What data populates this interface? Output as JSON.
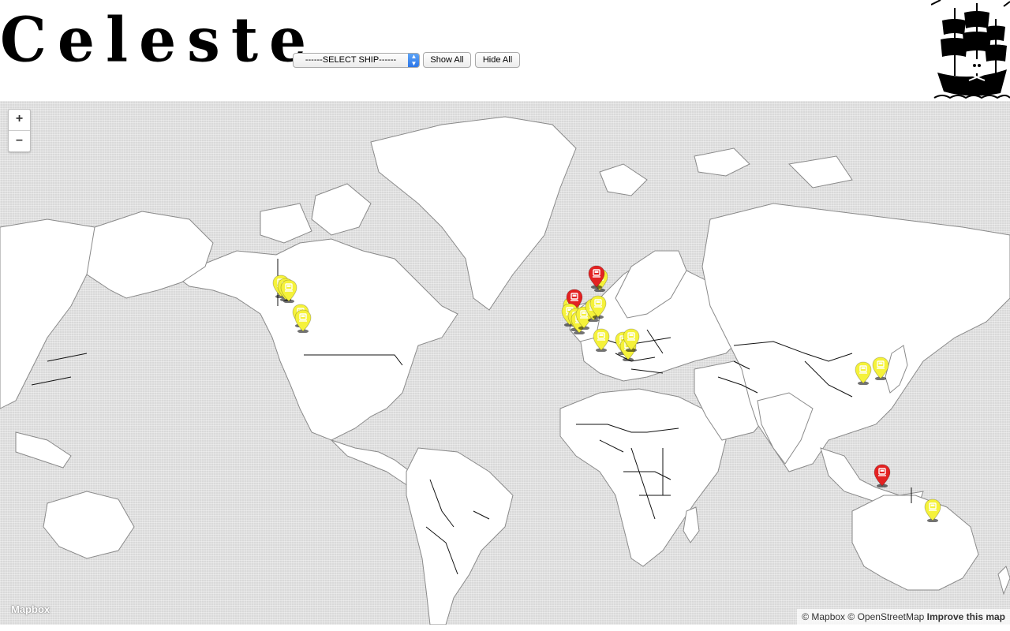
{
  "header": {
    "logo_text": "Celeste",
    "select": {
      "selected": "------SELECT SHIP------"
    },
    "show_all_label": "Show All",
    "hide_all_label": "Hide All"
  },
  "map": {
    "zoom_in_label": "+",
    "zoom_out_label": "–",
    "brand_label": "Mapbox",
    "attribution": {
      "mapbox": "© Mapbox",
      "osm": "© OpenStreetMap",
      "improve": "Improve this map"
    },
    "marker_colors": {
      "default": "#f5f23a",
      "selected": "#e32222"
    },
    "markers": [
      {
        "id": "m1",
        "color": "yellow",
        "icon": "ship-icon"
      },
      {
        "id": "m2",
        "color": "yellow",
        "icon": "ship-icon"
      },
      {
        "id": "m3",
        "color": "yellow",
        "icon": "ship-icon"
      },
      {
        "id": "m4",
        "color": "yellow",
        "icon": "ship-icon"
      },
      {
        "id": "m5",
        "color": "yellow",
        "icon": "ship-icon"
      },
      {
        "id": "m6",
        "color": "red",
        "icon": "ship-icon"
      },
      {
        "id": "m7",
        "color": "yellow",
        "icon": "ship-icon"
      },
      {
        "id": "m8",
        "color": "red",
        "icon": "ship-icon"
      },
      {
        "id": "m9",
        "color": "yellow",
        "icon": "ship-icon"
      },
      {
        "id": "m10",
        "color": "yellow",
        "icon": "ship-icon"
      },
      {
        "id": "m11",
        "color": "yellow",
        "icon": "ship-icon"
      },
      {
        "id": "m12",
        "color": "yellow",
        "icon": "ship-icon"
      },
      {
        "id": "m13",
        "color": "yellow",
        "icon": "ship-icon"
      },
      {
        "id": "m14",
        "color": "yellow",
        "icon": "ship-icon"
      },
      {
        "id": "m15",
        "color": "yellow",
        "icon": "ship-icon"
      },
      {
        "id": "m16",
        "color": "yellow",
        "icon": "ship-icon"
      },
      {
        "id": "m17",
        "color": "yellow",
        "icon": "ship-icon"
      },
      {
        "id": "m18",
        "color": "yellow",
        "icon": "ship-icon"
      },
      {
        "id": "m19",
        "color": "yellow",
        "icon": "ship-icon"
      },
      {
        "id": "m20",
        "color": "yellow",
        "icon": "ship-icon"
      },
      {
        "id": "m21",
        "color": "red",
        "icon": "ship-icon"
      },
      {
        "id": "m22",
        "color": "yellow",
        "icon": "ship-icon"
      },
      {
        "id": "m23",
        "color": "yellow",
        "icon": "ship-icon"
      }
    ]
  }
}
